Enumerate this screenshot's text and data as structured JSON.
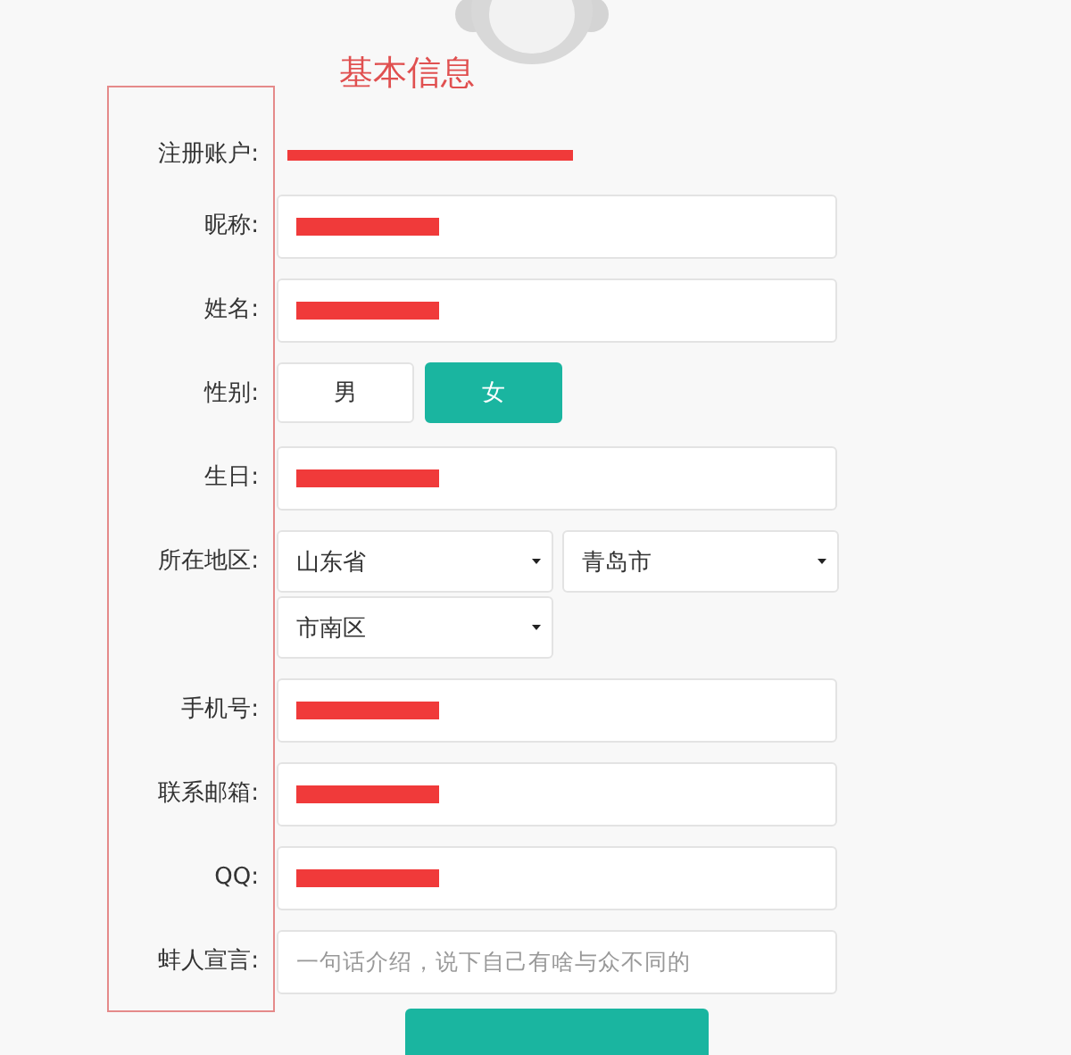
{
  "section_title": "基本信息",
  "account": {
    "label": "注册账户:",
    "redacted": true
  },
  "fields": [
    {
      "kind": "input",
      "label": "昵称:",
      "redacted": true
    },
    {
      "kind": "input",
      "label": "姓名:",
      "redacted": true
    },
    {
      "kind": "gender",
      "label": "性别:",
      "options": [
        {
          "label": "男",
          "selected": false
        },
        {
          "label": "女",
          "selected": true
        }
      ]
    },
    {
      "kind": "input",
      "label": "生日:",
      "redacted": true
    },
    {
      "kind": "region",
      "label": "所在地区:",
      "selects": [
        "山东省",
        "青岛市",
        "市南区"
      ]
    },
    {
      "kind": "input",
      "label": "手机号:",
      "redacted": true
    },
    {
      "kind": "input",
      "label": "联系邮箱:",
      "redacted": true
    },
    {
      "kind": "input",
      "label": "QQ:",
      "redacted": true
    },
    {
      "kind": "input",
      "label": "蚌人宣言:",
      "placeholder": "一句话介绍，说下自己有啥与众不同的"
    }
  ]
}
